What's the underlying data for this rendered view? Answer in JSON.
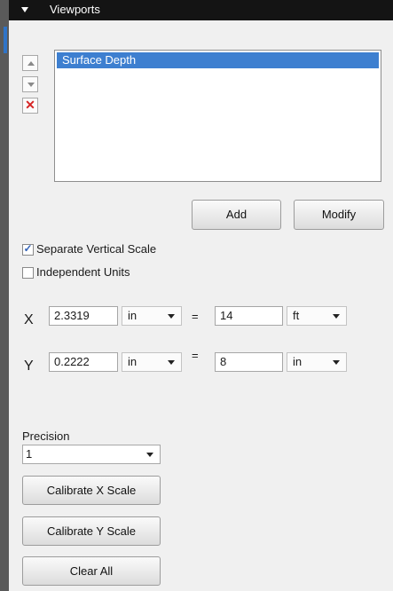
{
  "header": {
    "title": "Viewports",
    "collapse_icon": "triangle-down-icon"
  },
  "viewport_list": {
    "items": [
      {
        "label": "Surface Depth",
        "selected": true
      }
    ]
  },
  "side_buttons": {
    "up_icon": "arrow-up-icon",
    "down_icon": "arrow-down-icon",
    "delete_icon": "delete-x-icon",
    "delete_glyph": "✕"
  },
  "actions": {
    "add_label": "Add",
    "modify_label": "Modify"
  },
  "options": {
    "separate_vertical_scale": {
      "label": "Separate Vertical Scale",
      "checked": true
    },
    "independent_units": {
      "label": "Independent Units",
      "checked": false
    }
  },
  "scale": {
    "x": {
      "axis": "X",
      "value": "2.3319",
      "unit": "in",
      "equals": "=",
      "target_value": "14",
      "target_unit": "ft"
    },
    "y": {
      "axis": "Y",
      "value": "0.2222",
      "unit": "in",
      "equals": "=",
      "target_value": "8",
      "target_unit": "in"
    }
  },
  "precision": {
    "label": "Precision",
    "value": "1"
  },
  "buttons": {
    "calibrate_x": "Calibrate X Scale",
    "calibrate_y": "Calibrate Y Scale",
    "clear_all": "Clear All"
  },
  "colors": {
    "header_bg": "#141414",
    "selection": "#3d7fd0",
    "delete_red": "#d62424",
    "accent_blue": "#2f74c8"
  }
}
